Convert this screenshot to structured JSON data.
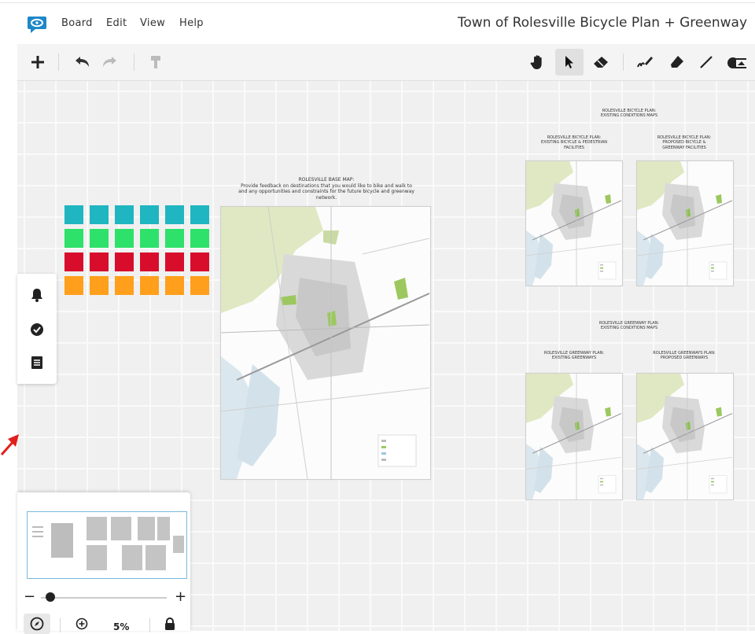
{
  "menu": {
    "items": [
      "Board",
      "Edit",
      "View",
      "Help"
    ],
    "board_title": "Town of Rolesville Bicycle Plan + Greenway"
  },
  "toolbar": {
    "left_tools": [
      "add-icon",
      "undo-icon",
      "redo-icon",
      "format-painter-icon"
    ],
    "right_tools": [
      "hand-icon",
      "pointer-icon",
      "eraser-icon",
      "pen-icon",
      "highlighter-icon",
      "line-icon",
      "shape-icon"
    ],
    "active_tool": "pointer-icon"
  },
  "side_panel": [
    "bell-icon",
    "check-circle-icon",
    "list-icon"
  ],
  "sticky_colors": [
    "#1fb6c1",
    "#2ee16a",
    "#d80d2c",
    "#ff9f1c"
  ],
  "sticky_columns": 6,
  "base_map": {
    "caption": "ROLESVILLE BASE MAP:\nProvide feedback on destinations that you would like to bike and walk to and any opportunities and constraints for the future bicycle and greenway network."
  },
  "bicycle_section": {
    "heading": "ROLESVILLE BICYCLE PLAN:\nEXISTING CONDITIONS MAPS",
    "maps": [
      {
        "caption": "ROLESVILLE BICYCLE PLAN:\nEXISTING BICYCLE & PEDESTRIAN\nFACILITIES"
      },
      {
        "caption": "ROLESVILLE BICYCLE PLAN:\nPROPOSED BICYCLE &\nGREENWAY FACILITIES"
      }
    ]
  },
  "greenway_section": {
    "heading": "ROLESVILLE GREENWAY PLAN:\nEXISTING CONDITIONS MAPS",
    "maps": [
      {
        "caption": "ROLESVILLE GREENWAY PLAN:\nEXISTING GREENWAYS"
      },
      {
        "caption": "ROLESVILLE GREENWAYS PLAN:\nPROPOSED GREENWAYS"
      }
    ]
  },
  "navigator": {
    "zoom_minus": "−",
    "zoom_plus": "+",
    "zoom_value": "5%",
    "zoom_level": 0.05,
    "buttons": [
      "compass-icon",
      "zoom-in-icon",
      "lock-icon"
    ]
  },
  "colors": {
    "accent": "#1e88c7",
    "annotation_arrow": "#e0201c"
  }
}
